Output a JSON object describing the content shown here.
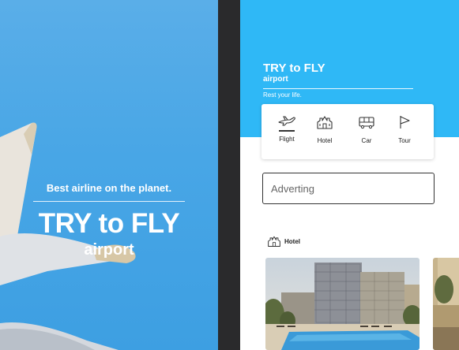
{
  "splash": {
    "tagline": "Best airline on the planet.",
    "title": "TRY to FLY",
    "subtitle": "airport"
  },
  "app": {
    "title": "TRY to FLY",
    "subtitle": "airport",
    "slogan": "Rest your life.",
    "categories": [
      {
        "label": "Flight",
        "icon": "plane-icon",
        "selected": true
      },
      {
        "label": "Hotel",
        "icon": "building-icon",
        "selected": false
      },
      {
        "label": "Car",
        "icon": "bus-icon",
        "selected": false
      },
      {
        "label": "Tour",
        "icon": "flag-icon",
        "selected": false
      }
    ],
    "search": {
      "placeholder": "Adverting"
    },
    "section": {
      "label": "Hotel",
      "icon": "building-icon"
    }
  },
  "colors": {
    "hero_blue": "#2fb8f6",
    "splash_blue": "#4aa8e6",
    "divider": "#2a2a2c"
  }
}
